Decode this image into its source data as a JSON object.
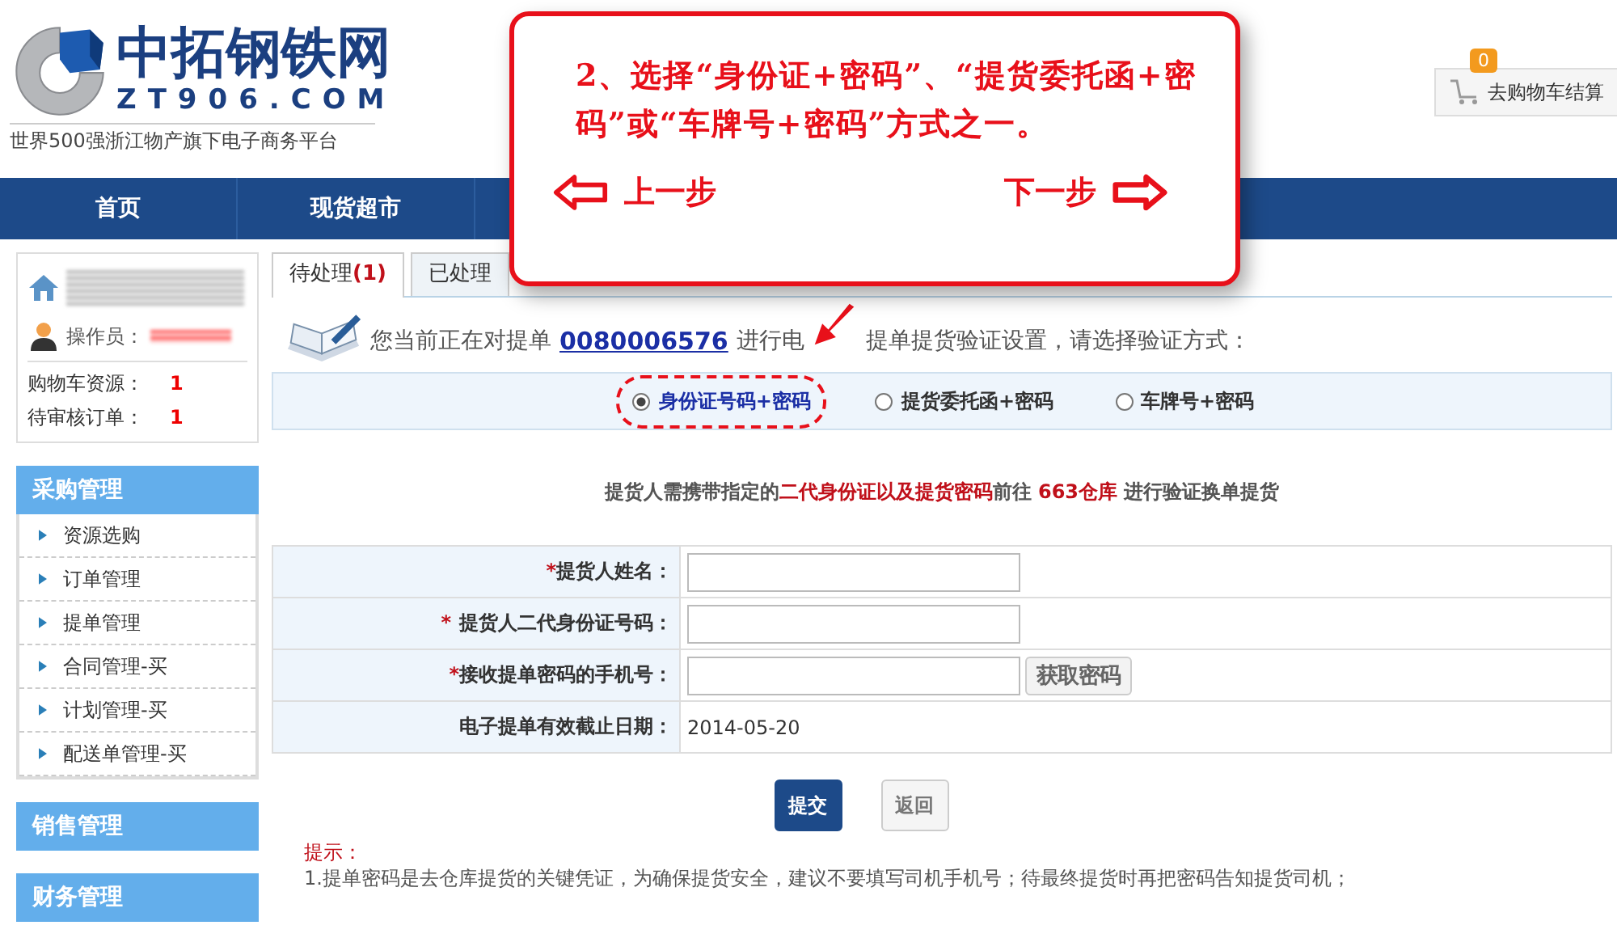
{
  "header": {
    "logo_title": "中拓钢铁网",
    "logo_domain": "ZT906.COM",
    "tagline": "世界500强浙江物产旗下电子商务平台",
    "cart": {
      "badge": "0",
      "label": "去购物车结算"
    }
  },
  "nav": [
    "首页",
    "现货超市"
  ],
  "guide": {
    "text": "2、选择“身份证+密码”、“提货委托函+密码”或“车牌号+密码”方式之一。",
    "prev": "上一步",
    "next": "下一步"
  },
  "user": {
    "operator_label": "操作员：",
    "stats": [
      {
        "label": "购物车资源：",
        "value": "1"
      },
      {
        "label": "待审核订单：",
        "value": "1"
      }
    ]
  },
  "sidebar": [
    {
      "title": "采购管理",
      "items": [
        "资源选购",
        "订单管理",
        "提单管理",
        "合同管理-买",
        "计划管理-买",
        "配送单管理-买"
      ]
    },
    {
      "title": "销售管理"
    },
    {
      "title": "财务管理"
    }
  ],
  "tabs": [
    {
      "label": "待处理**(1)**",
      "selected": true
    },
    {
      "label": "已处理",
      "selected": false
    }
  ],
  "intro": {
    "before": "您当前正在对提单",
    "order_no": "0080006576",
    "middle": "进行电",
    "after": "提单提货验证设置，请选择验证方式："
  },
  "methods": [
    {
      "label": "身份证号码+密码",
      "selected": true
    },
    {
      "label": "提货委托函+密码",
      "selected": false
    },
    {
      "label": "车牌号+密码",
      "selected": false
    }
  ],
  "notice": "提货人需携带指定的**二代身份证以及提货密码**前往 **663仓库** 进行验证换单提货",
  "form": [
    {
      "label": "提货人姓名：",
      "mark": "*",
      "kind": "input"
    },
    {
      "label": "提货人二代身份证号码：",
      "mark": "*",
      "kind": "input"
    },
    {
      "label": "接收提单密码的手机号：",
      "mark": "*",
      "kind": "input_button",
      "button": "获取密码"
    },
    {
      "label": "电子提单有效截止日期：",
      "kind": "text",
      "value": "2014-05-20"
    }
  ],
  "buttons": [
    {
      "label": "提交",
      "kind": "primary"
    },
    {
      "label": "返回",
      "kind": "secondary"
    }
  ],
  "tips": {
    "title": "提示：",
    "lines": [
      "1.提单密码是去仓库提货的关键凭证，为确保提货安全，建议不要填写司机手机号；待最终提货时再把密码告知提货司机；"
    ]
  }
}
